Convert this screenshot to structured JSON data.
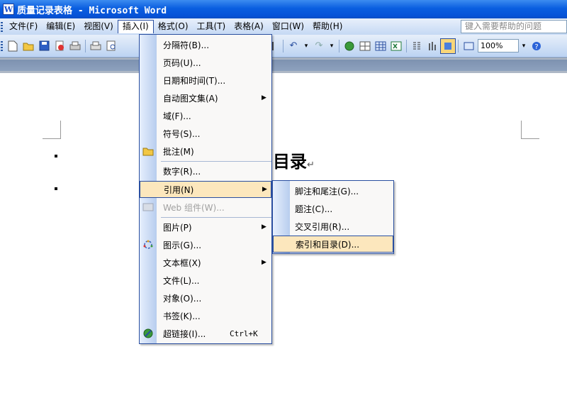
{
  "window": {
    "title": "质量记录表格 - Microsoft Word"
  },
  "menubar": {
    "items": [
      "文件(F)",
      "编辑(E)",
      "视图(V)",
      "插入(I)",
      "格式(O)",
      "工具(T)",
      "表格(A)",
      "窗口(W)",
      "帮助(H)"
    ],
    "help_placeholder": "键入需要帮助的问题"
  },
  "toolbar": {
    "zoom": "100%"
  },
  "document": {
    "heading": "目录",
    "paragraph_mark": "↵"
  },
  "insert_menu": {
    "items": [
      {
        "label": "分隔符(B)..."
      },
      {
        "label": "页码(U)..."
      },
      {
        "label": "日期和时间(T)..."
      },
      {
        "label": "自动图文集(A)"
      },
      {
        "label": "域(F)..."
      },
      {
        "label": "符号(S)..."
      },
      {
        "label": "批注(M)"
      },
      {
        "label": "数字(R)..."
      },
      {
        "label": "引用(N)"
      },
      {
        "label": "Web 组件(W)..."
      },
      {
        "label": "图片(P)"
      },
      {
        "label": "图示(G)..."
      },
      {
        "label": "文本框(X)"
      },
      {
        "label": "文件(L)..."
      },
      {
        "label": "对象(O)..."
      },
      {
        "label": "书签(K)..."
      },
      {
        "label": "超链接(I)...",
        "shortcut": "Ctrl+K"
      }
    ]
  },
  "reference_submenu": {
    "items": [
      "脚注和尾注(G)...",
      "题注(C)...",
      "交叉引用(R)...",
      "索引和目录(D)..."
    ]
  },
  "colors": {
    "titlebar": "#0a5ee0",
    "highlight": "#fce7bd",
    "menu_border": "#2a4fa0"
  }
}
